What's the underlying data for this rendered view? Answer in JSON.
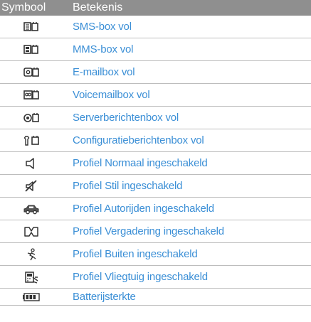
{
  "header": {
    "symbol": "Symbool",
    "meaning": "Betekenis"
  },
  "rows": [
    {
      "icon": "sms-box-full-icon",
      "label": "SMS-box vol"
    },
    {
      "icon": "mms-box-full-icon",
      "label": "MMS-box vol"
    },
    {
      "icon": "email-box-full-icon",
      "label": "E-mailbox vol"
    },
    {
      "icon": "voicemail-box-full-icon",
      "label": "Voicemailbox vol"
    },
    {
      "icon": "server-message-box-full-icon",
      "label": "Serverberichtenbox vol"
    },
    {
      "icon": "configuration-message-box-full-icon",
      "label": "Configuratieberichtenbox vol"
    },
    {
      "icon": "profile-normal-icon",
      "label": "Profiel Normaal ingeschakeld"
    },
    {
      "icon": "profile-silent-icon",
      "label": "Profiel Stil ingeschakeld"
    },
    {
      "icon": "profile-driving-icon",
      "label": "Profiel Autorijden ingeschakeld"
    },
    {
      "icon": "profile-meeting-icon",
      "label": "Profiel Vergadering ingeschakeld"
    },
    {
      "icon": "profile-outdoor-icon",
      "label": "Profiel Buiten ingeschakeld"
    },
    {
      "icon": "profile-offline-icon",
      "label": "Profiel Vliegtuig ingeschakeld"
    },
    {
      "icon": "battery-strength-icon",
      "label": "Batterijsterkte"
    }
  ],
  "colors": {
    "header_bg": "#8f8f8f",
    "label": "#3b8fd6",
    "divider": "#bdbdbd"
  }
}
